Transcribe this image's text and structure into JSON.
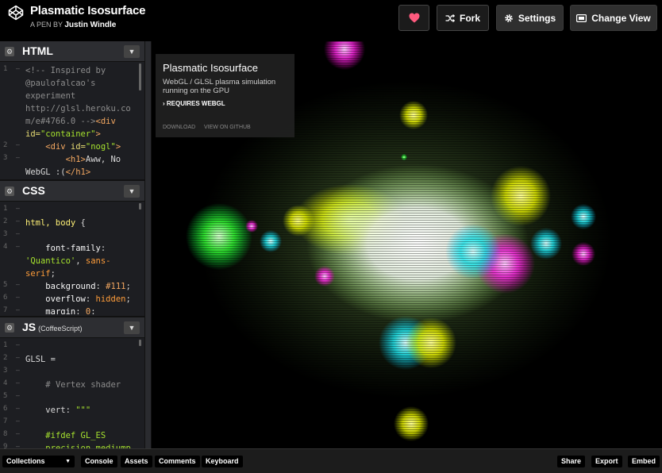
{
  "header": {
    "title": "Plasmatic Isosurface",
    "byline_prefix": "A PEN BY",
    "author": "Justin Windle",
    "fork_label": "Fork",
    "settings_label": "Settings",
    "change_view_label": "Change View"
  },
  "editors": {
    "html": {
      "title": "HTML",
      "lines": [
        {
          "n": "1",
          "html": "<span class='cm'>&lt;!-- Inspired by</span>"
        },
        {
          "n": "",
          "html": "<span class='cm'>@paulofalcao's</span>"
        },
        {
          "n": "",
          "html": "<span class='cm'>experiment</span>"
        },
        {
          "n": "",
          "html": "<span class='cm'>http://glsl.heroku.co</span>"
        },
        {
          "n": "",
          "html": "<span class='cm'>m/e#4766.0 --&gt;</span><span class='tag'>&lt;div</span>"
        },
        {
          "n": "",
          "html": "<span class='attr'>id=</span><span class='str'>\"container\"</span><span class='tag'>&gt;</span>"
        },
        {
          "n": "2",
          "html": "    <span class='tag'>&lt;div</span> <span class='attr'>id=</span><span class='str'>\"nogl\"</span><span class='tag'>&gt;</span>"
        },
        {
          "n": "3",
          "html": "        <span class='tag'>&lt;h1&gt;</span>Aww, No"
        },
        {
          "n": "",
          "html": "WebGL :(<span class='tag'>&lt;/h1&gt;</span>"
        }
      ]
    },
    "css": {
      "title": "CSS",
      "lines": [
        {
          "n": "1",
          "html": ""
        },
        {
          "n": "2",
          "html": "<span class='sel'>html, body</span> {"
        },
        {
          "n": "3",
          "html": ""
        },
        {
          "n": "4",
          "html": "    <span class='kw'>font-family</span>:"
        },
        {
          "n": "",
          "html": "<span class='str'>'Quantico'</span>, <span class='val'>sans-</span>"
        },
        {
          "n": "",
          "html": "<span class='val'>serif</span>;"
        },
        {
          "n": "5",
          "html": "    <span class='kw'>background</span>: <span class='num'>#111</span>;"
        },
        {
          "n": "6",
          "html": "    <span class='kw'>overflow</span>: <span class='val'>hidden</span>;"
        },
        {
          "n": "7",
          "html": "    <span class='kw'>margin</span>: <span class='num'>0</span>;"
        }
      ]
    },
    "js": {
      "title": "JS",
      "subtitle": "(CoffeeScript)",
      "lines": [
        {
          "n": "1",
          "html": ""
        },
        {
          "n": "2",
          "html": "GLSL ="
        },
        {
          "n": "3",
          "html": ""
        },
        {
          "n": "4",
          "html": "    <span class='cm'># Vertex shader</span>"
        },
        {
          "n": "5",
          "html": ""
        },
        {
          "n": "6",
          "html": "    vert: <span class='str'>\"\"\"</span>"
        },
        {
          "n": "7",
          "html": ""
        },
        {
          "n": "8",
          "html": "    <span class='str'>#ifdef GL_ES</span>"
        },
        {
          "n": "9",
          "html": "    <span class='str'>precision mediump</span>"
        }
      ]
    }
  },
  "preview": {
    "info_title": "Plasmatic Isosurface",
    "info_desc": "WebGL / GLSL plasma simulation running on the GPU",
    "info_requires": "› REQUIRES WEBGL",
    "download_label": "DOWNLOAD",
    "github_label": "VIEW ON GITHUB"
  },
  "footer": {
    "collections": "Collections",
    "console": "Console",
    "assets": "Assets",
    "comments": "Comments",
    "keyboard": "Keyboard",
    "share": "Share",
    "export": "Export",
    "embed": "Embed"
  },
  "colors": {
    "accent_heart": "#ff5a7e",
    "editor_bg": "#1d1e22"
  },
  "icons": {
    "logo": "codepen-logo-icon",
    "heart": "heart-icon",
    "fork": "fork-icon",
    "settings": "gear-icon",
    "change_view": "layout-icon"
  }
}
